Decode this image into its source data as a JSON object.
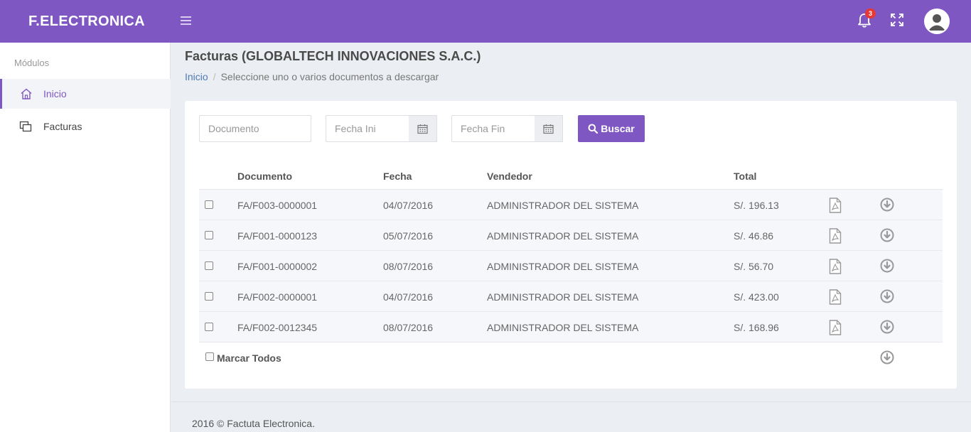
{
  "header": {
    "brand": "F.ELECTRONICA",
    "notification_count": "3",
    "accent_color": "#7e57c2"
  },
  "sidebar": {
    "title": "Módulos",
    "items": [
      {
        "label": "Inicio",
        "icon": "home-icon",
        "active": true
      },
      {
        "label": "Facturas",
        "icon": "documents-icon",
        "active": false
      }
    ]
  },
  "page": {
    "title": "Facturas (GLOBALTECH INNOVACIONES S.A.C.)",
    "breadcrumb": {
      "home": "Inicio",
      "current": "Seleccione uno o varios documentos a descargar"
    }
  },
  "filters": {
    "documento_placeholder": "Documento",
    "fecha_ini_placeholder": "Fecha Ini",
    "fecha_fin_placeholder": "Fecha Fin",
    "search_label": "Buscar"
  },
  "table": {
    "columns": [
      "Documento",
      "Fecha",
      "Vendedor",
      "Total"
    ],
    "rows": [
      {
        "documento": "FA/F003-0000001",
        "fecha": "04/07/2016",
        "vendedor": "ADMINISTRADOR DEL SISTEMA",
        "total": "S/. 196.13"
      },
      {
        "documento": "FA/F001-0000123",
        "fecha": "05/07/2016",
        "vendedor": "ADMINISTRADOR DEL SISTEMA",
        "total": "S/. 46.86"
      },
      {
        "documento": "FA/F001-0000002",
        "fecha": "08/07/2016",
        "vendedor": "ADMINISTRADOR DEL SISTEMA",
        "total": "S/. 56.70"
      },
      {
        "documento": "FA/F002-0000001",
        "fecha": "04/07/2016",
        "vendedor": "ADMINISTRADOR DEL SISTEMA",
        "total": "S/. 423.00"
      },
      {
        "documento": "FA/F002-0012345",
        "fecha": "08/07/2016",
        "vendedor": "ADMINISTRADOR DEL SISTEMA",
        "total": "S/. 168.96"
      }
    ],
    "mark_all_label": "Marcar Todos"
  },
  "footer": {
    "text": "2016 © Factuta Electronica."
  }
}
